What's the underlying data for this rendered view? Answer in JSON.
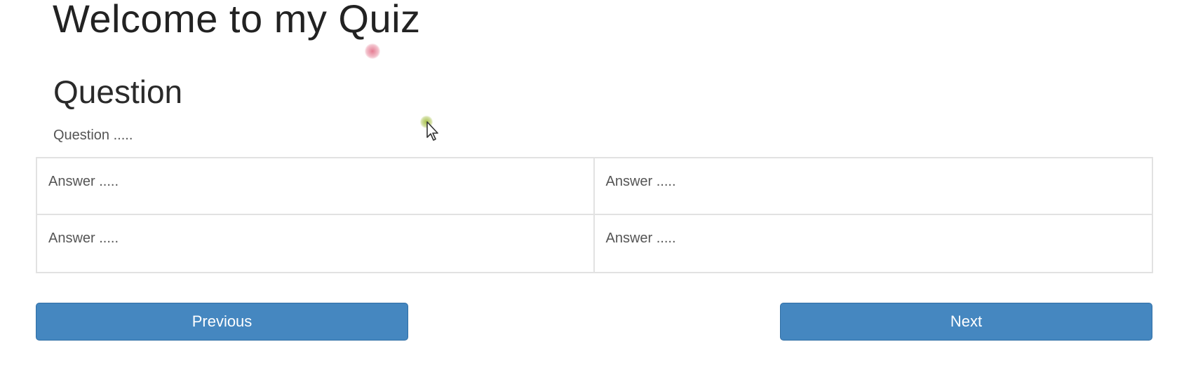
{
  "header": {
    "title": "Welcome to my Quiz"
  },
  "question": {
    "heading": "Question",
    "text": "Question ....."
  },
  "answers": [
    "Answer .....",
    "Answer .....",
    "Answer .....",
    "Answer ....."
  ],
  "navigation": {
    "previous_label": "Previous",
    "next_label": "Next"
  },
  "colors": {
    "button_bg": "#4587c0",
    "button_border": "#2f6ea5",
    "button_text": "#ffffff",
    "grid_border": "#e2e2e2"
  },
  "icons": {
    "cursor": "mouse-pointer-icon"
  }
}
